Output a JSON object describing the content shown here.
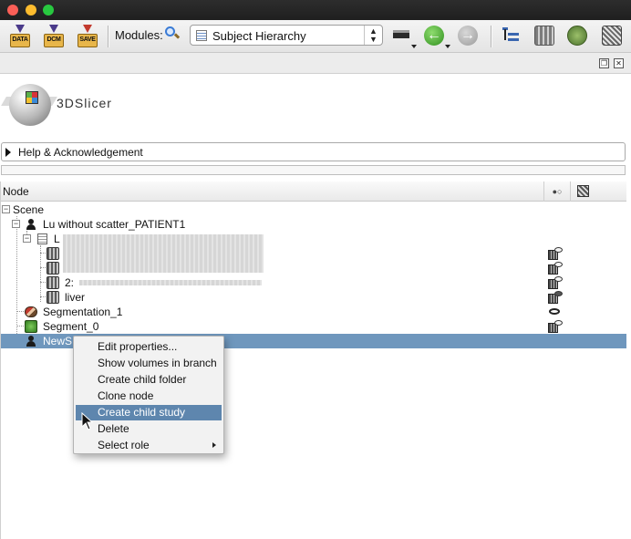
{
  "toolbar": {
    "data_label": "DATA",
    "dcm_label": "DCM",
    "save_label": "SAVE",
    "modules_label": "Modules:",
    "module_selected": "Subject Hierarchy"
  },
  "logo": {
    "text": "3DSlicer"
  },
  "help_section": {
    "label": "Help & Acknowledgement"
  },
  "tree": {
    "column_node": "Node",
    "rows": [
      {
        "label": "Scene"
      },
      {
        "label": "Lu without scatter_PATIENT1"
      },
      {
        "label": "L"
      },
      {
        "label": ""
      },
      {
        "label": ""
      },
      {
        "label": "2:"
      },
      {
        "label": "liver"
      },
      {
        "label": "Segmentation_1"
      },
      {
        "label": "Segment_0"
      },
      {
        "label": "NewS"
      }
    ]
  },
  "context_menu": {
    "items": [
      {
        "label": "Edit properties..."
      },
      {
        "label": "Show volumes in branch"
      },
      {
        "label": "Create child folder"
      },
      {
        "label": "Clone node"
      },
      {
        "label": "Create child study"
      },
      {
        "label": "Delete"
      },
      {
        "label": "Select role"
      }
    ],
    "active_item": "Create child study"
  },
  "colors": {
    "selection": "#6f97bd",
    "menu_highlight": "#5e86ae",
    "toolbar_bg": "#e8e8e8"
  }
}
